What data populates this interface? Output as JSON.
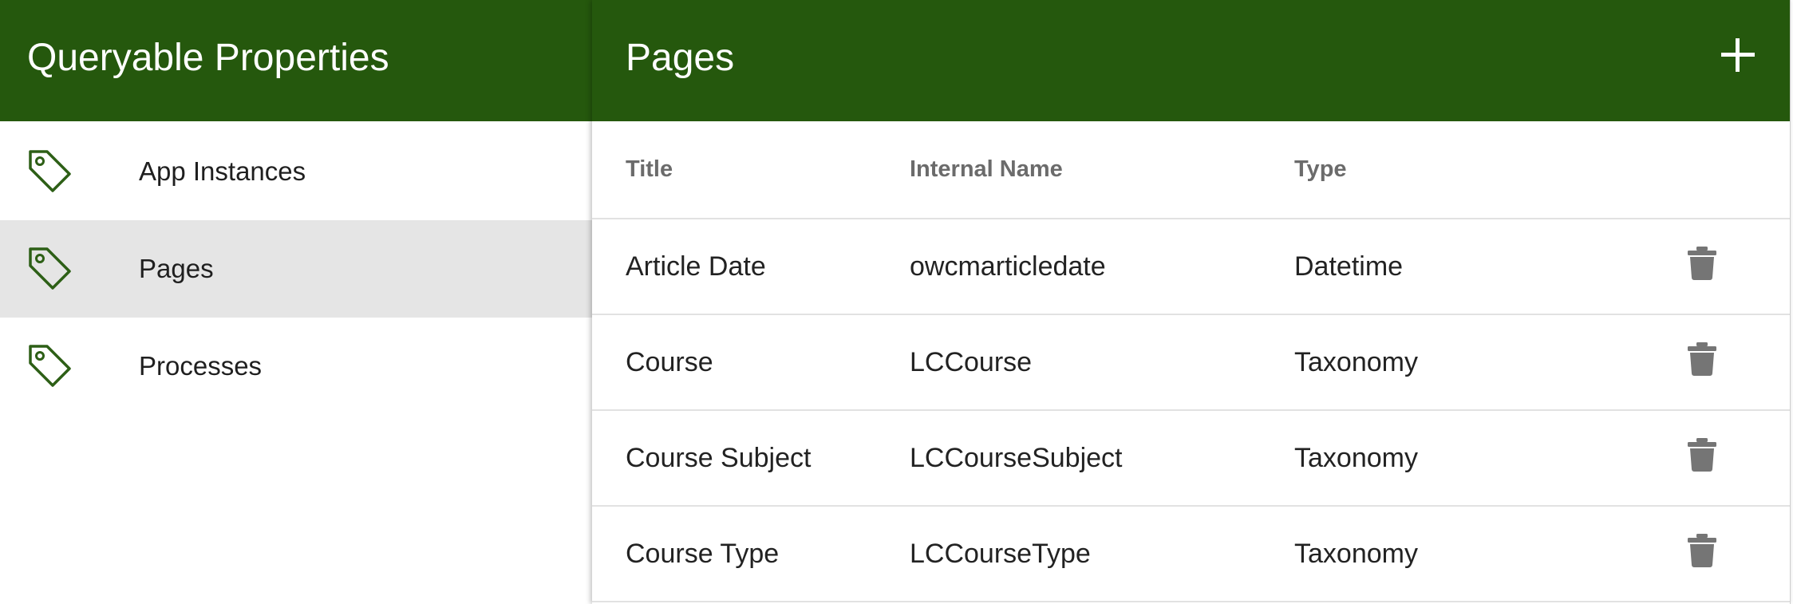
{
  "sidebar": {
    "title": "Queryable Properties",
    "items": [
      {
        "label": "App Instances",
        "icon": "tag-icon",
        "active": false
      },
      {
        "label": "Pages",
        "icon": "tag-icon",
        "active": true
      },
      {
        "label": "Processes",
        "icon": "tag-icon",
        "active": false
      }
    ]
  },
  "main": {
    "title": "Pages",
    "add_icon": "plus-icon",
    "columns": [
      "Title",
      "Internal Name",
      "Type"
    ],
    "rows": [
      {
        "title": "Article Date",
        "internal_name": "owcmarticledate",
        "type": "Datetime"
      },
      {
        "title": "Course",
        "internal_name": "LCCourse",
        "type": "Taxonomy"
      },
      {
        "title": "Course Subject",
        "internal_name": "LCCourseSubject",
        "type": "Taxonomy"
      },
      {
        "title": "Course Type",
        "internal_name": "LCCourseType",
        "type": "Taxonomy"
      }
    ],
    "delete_icon": "trash-icon"
  },
  "colors": {
    "header_bg": "#25580d",
    "icon_green": "#2d5f16",
    "active_item_bg": "#e5e5e5",
    "trash_gray": "#757575"
  }
}
